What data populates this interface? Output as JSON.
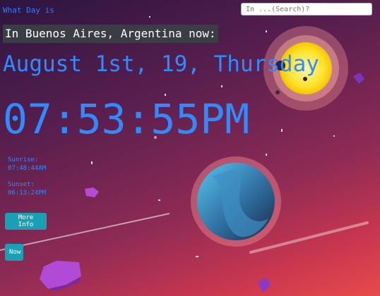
{
  "header": {
    "logo_text": "What Day is",
    "search_placeholder": "In ...(Search)?"
  },
  "location": {
    "city_line": "In Buenos Aires, Argentina now:"
  },
  "clock": {
    "date": "August 1st, 19, Thursday",
    "time": "07:53:55PM"
  },
  "sun": {
    "sunrise_label": "Sunrise:",
    "sunrise_time": "07:48:44AM",
    "sunset_label": "Sunset:",
    "sunset_time": "06:13:24PM"
  },
  "actions": {
    "more_info_label": "More Info",
    "now_label": "Now"
  },
  "colors": {
    "text_accent": "#2f8bff",
    "button_bg": "#1aa0b5",
    "city_bg": "#3a3d44"
  }
}
